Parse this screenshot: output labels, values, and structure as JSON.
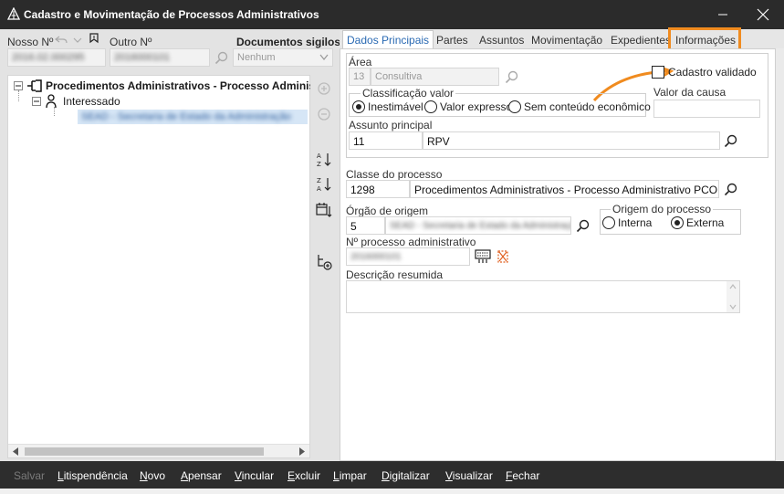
{
  "window": {
    "title": "Cadastro e Movimentação de Processos Administrativos"
  },
  "left": {
    "labels": {
      "nosso": "Nosso Nº",
      "outro": "Outro Nº",
      "sigilosos": "Documentos sigilosos"
    },
    "nosso_value": "2016.02.000295",
    "outro_value": "2016000101",
    "sigilosos_value": "Nenhum",
    "tree": {
      "root": "Procedimentos Administrativos - Processo Administrati",
      "child": "Interessado",
      "leaf": "SEAD - Secretaria de Estado da Administração"
    }
  },
  "tabs": [
    "Dados Principais",
    "Partes",
    "Assuntos",
    "Movimentação",
    "Expedientes",
    "Informações"
  ],
  "form": {
    "area": {
      "label": "Área",
      "code": "13",
      "text": "Consultiva"
    },
    "cadastro_validado": "Cadastro validado",
    "classificacao": {
      "label": "Classificação valor",
      "options": [
        "Inestimável",
        "Valor expresso",
        "Sem conteúdo econômico"
      ]
    },
    "valor_causa": {
      "label": "Valor da causa",
      "value": ""
    },
    "assunto": {
      "label": "Assunto principal",
      "code": "11",
      "text": "RPV"
    },
    "classe": {
      "label": "Classe do processo",
      "code": "1298",
      "text": "Procedimentos Administrativos - Processo Administrativo PCON"
    },
    "orgao": {
      "label": "Órgão de origem",
      "code": "5",
      "text": "SEAD - Secretaria de Estado da Administração"
    },
    "origem": {
      "label": "Origem do processo",
      "options": [
        "Interna",
        "Externa"
      ]
    },
    "nprocesso": {
      "label": "Nº processo administrativo",
      "value": "2016000101"
    },
    "descricao": {
      "label": "Descrição resumida",
      "value": ""
    }
  },
  "bottom": {
    "salvar": "Salvar",
    "litispendencia": "Litispendência",
    "novo": "Novo",
    "apensar": "Apensar",
    "vincular": "Vincular",
    "excluir": "Excluir",
    "limpar": "Limpar",
    "digitalizar": "Digitalizar",
    "visualizar": "Visualizar",
    "fechar": "Fechar"
  },
  "colors": {
    "accent": "#2a6ab3",
    "highlight": "#f08b1f",
    "titlebar": "#2b2b2b"
  }
}
